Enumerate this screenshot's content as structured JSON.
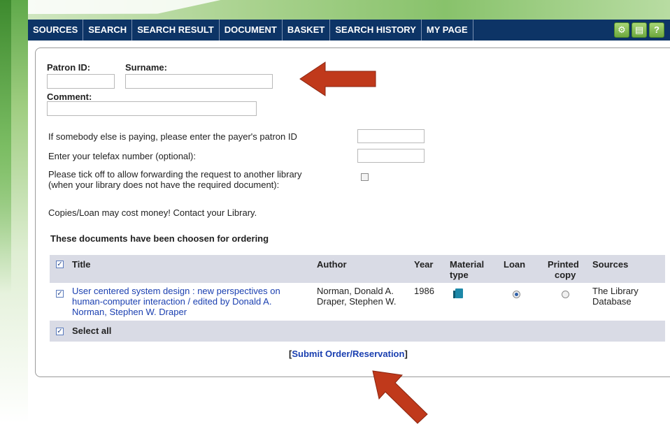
{
  "nav": {
    "items": [
      "SOURCES",
      "SEARCH",
      "SEARCH RESULT",
      "DOCUMENT",
      "BASKET",
      "SEARCH HISTORY",
      "MY PAGE"
    ],
    "tools": [
      {
        "icon": "tools-icon",
        "glyph": "⚙"
      },
      {
        "icon": "print-icon",
        "glyph": "▤"
      },
      {
        "icon": "help-icon",
        "glyph": "?"
      }
    ]
  },
  "form": {
    "patron_id_label": "Patron ID:",
    "surname_label": "Surname:",
    "comment_label": "Comment:",
    "payer_text": "If somebody else is paying, please enter the payer's patron ID",
    "telefax_text": "Enter your telefax number (optional):",
    "forward_text_1": "Please tick off to allow forwarding the request to another library",
    "forward_text_2": "(when your library does not have the required document):",
    "cost_notice": "Copies/Loan may cost money! Contact your Library.",
    "chosen_heading": "These documents have been choosen for ordering"
  },
  "table": {
    "headers": {
      "title": "Title",
      "author": "Author",
      "year": "Year",
      "material_1": "Material",
      "material_2": "type",
      "loan": "Loan",
      "printed_1": "Printed",
      "printed_2": "copy",
      "sources": "Sources"
    },
    "row": {
      "title_1": "User centered system design : new perspectives on",
      "title_2": "human-computer interaction / edited by Donald A.",
      "title_3": "Norman, Stephen W. Draper",
      "author_1": "Norman, Donald A.",
      "author_2": "Draper, Stephen W.",
      "year": "1986",
      "material_icon": "book-icon",
      "loan_selected": true,
      "printed_selected": false,
      "source_1": "The Library",
      "source_2": "Database"
    },
    "select_all": "Select all"
  },
  "submit": {
    "open": "[",
    "label": "Submit Order/Reservation",
    "close": "]"
  },
  "colors": {
    "nav_bg": "#0d3466",
    "header_row_bg": "#d9dbe5",
    "link": "#1a3fb0",
    "arrow": "#c0391b"
  }
}
